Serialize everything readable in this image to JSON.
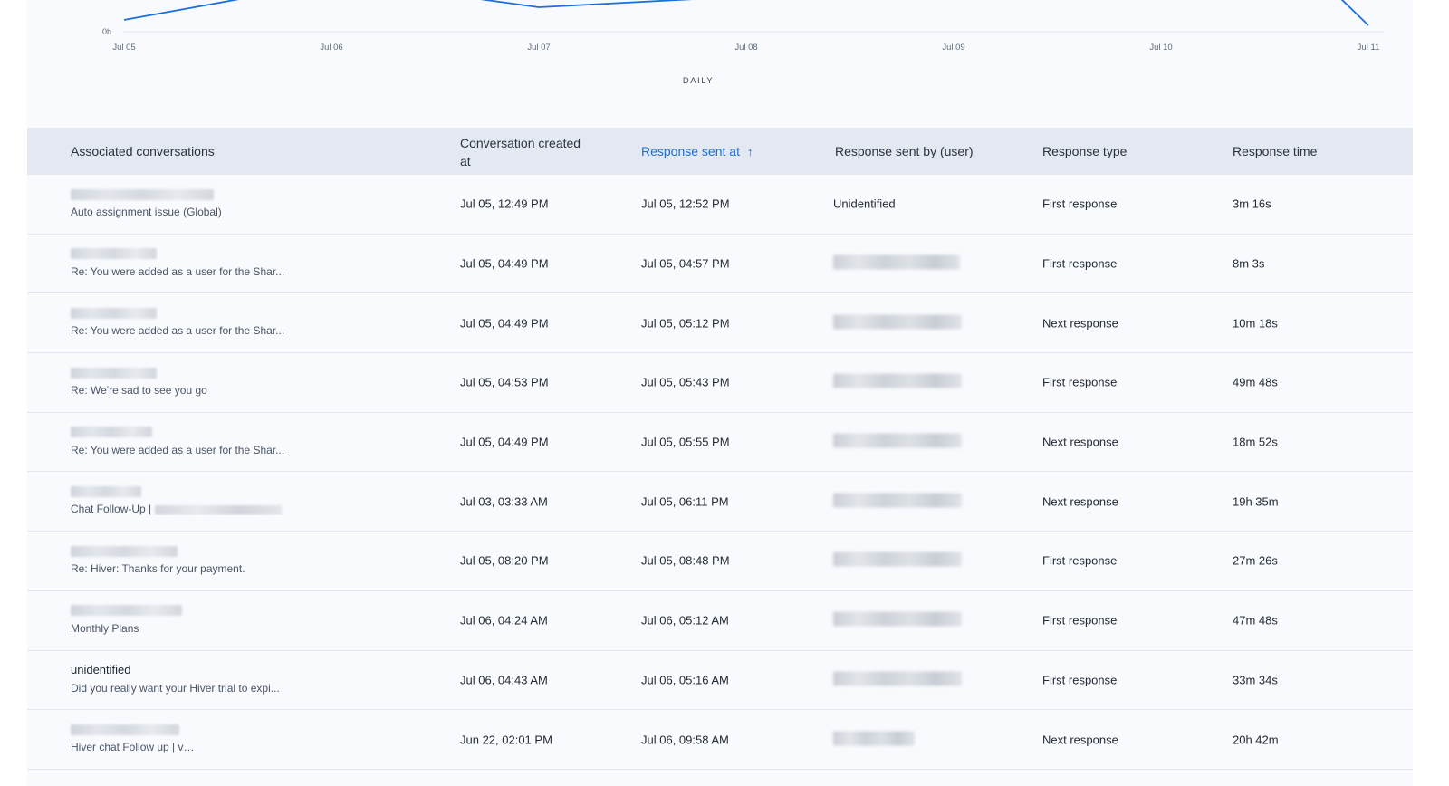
{
  "chart": {
    "y_tick": "0h",
    "x_ticks": [
      "Jul 05",
      "Jul 06",
      "Jul 07",
      "Jul 08",
      "Jul 09",
      "Jul 10",
      "Jul 11"
    ],
    "period_label": "DAILY",
    "line_color": "#1a6fd8"
  },
  "table": {
    "columns": {
      "conversations": "Associated conversations",
      "created_line1": "Conversation created",
      "created_line2": "at",
      "sent_at": "Response sent at",
      "sort_icon": "↑",
      "sent_by": "Response sent by (user)",
      "type": "Response type",
      "time": "Response time"
    },
    "rows": [
      {
        "title": "",
        "subject": "Auto assignment issue (Global)",
        "created": "Jul 05, 12:49 PM",
        "sent": "Jul 05, 12:52 PM",
        "user": "Unidentified",
        "type": "First response",
        "time": "3m 16s"
      },
      {
        "title": "",
        "subject": "Re: You were added as a user for the Shar...",
        "created": "Jul 05, 04:49 PM",
        "sent": "Jul 05, 04:57 PM",
        "user": "",
        "type": "First response",
        "time": "8m 3s"
      },
      {
        "title": "",
        "subject": "Re: You were added as a user for the Shar...",
        "created": "Jul 05, 04:49 PM",
        "sent": "Jul 05, 05:12 PM",
        "user": "",
        "type": "Next response",
        "time": "10m 18s"
      },
      {
        "title": "",
        "subject": "Re: We're sad to see you go",
        "created": "Jul 05, 04:53 PM",
        "sent": "Jul 05, 05:43 PM",
        "user": "",
        "type": "First response",
        "time": "49m 48s"
      },
      {
        "title": "",
        "subject": "Re: You were added as a user for the Shar...",
        "created": "Jul 05, 04:49 PM",
        "sent": "Jul 05, 05:55 PM",
        "user": "",
        "type": "Next response",
        "time": "18m 52s"
      },
      {
        "title": "",
        "subject": "Chat Follow-Up |",
        "created": "Jul 03, 03:33 AM",
        "sent": "Jul 05, 06:11 PM",
        "user": "",
        "type": "Next response",
        "time": "19h 35m"
      },
      {
        "title": "",
        "subject": "Re: Hiver: Thanks for your payment.",
        "created": "Jul 05, 08:20 PM",
        "sent": "Jul 05, 08:48 PM",
        "user": "",
        "type": "First response",
        "time": "27m 26s"
      },
      {
        "title": "",
        "subject": "Monthly Plans",
        "created": "Jul 06, 04:24 AM",
        "sent": "Jul 06, 05:12 AM",
        "user": "",
        "type": "First response",
        "time": "47m 48s"
      },
      {
        "title": "unidentified",
        "subject": "Did you really want your Hiver trial to expi...",
        "created": "Jul 06, 04:43 AM",
        "sent": "Jul 06, 05:16 AM",
        "user": "",
        "type": "First response",
        "time": "33m 34s"
      },
      {
        "title": "",
        "subject": "Hiver chat Follow up | v",
        "created": "Jun 22, 02:01 PM",
        "sent": "Jul 06, 09:58 AM",
        "user": "",
        "type": "Next response",
        "time": "20h 42m"
      }
    ]
  }
}
